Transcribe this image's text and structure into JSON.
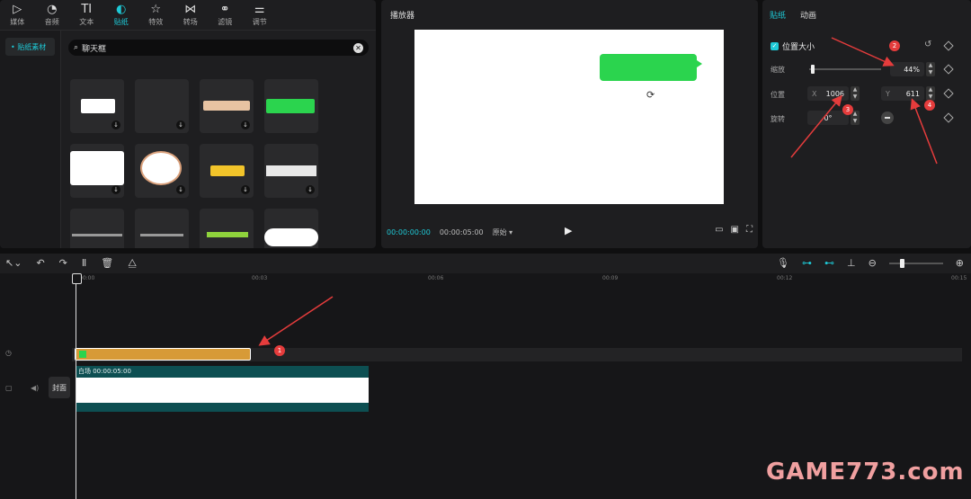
{
  "toolbar": {
    "items": [
      {
        "label": "媒体",
        "icon": "media-icon"
      },
      {
        "label": "音频",
        "icon": "audio-icon"
      },
      {
        "label": "文本",
        "icon": "text-icon"
      },
      {
        "label": "贴纸",
        "icon": "sticker-icon"
      },
      {
        "label": "特效",
        "icon": "effects-icon"
      },
      {
        "label": "转场",
        "icon": "transition-icon"
      },
      {
        "label": "滤镜",
        "icon": "filter-icon"
      },
      {
        "label": "调节",
        "icon": "adjust-icon"
      }
    ],
    "active": "贴纸"
  },
  "library": {
    "side_item": "• 贴纸素材",
    "search_value": "聊天框"
  },
  "player": {
    "title": "播放器",
    "time_current": "00:00:00:00",
    "time_total": "00:00:05:00",
    "ratio_label": "原始 ▾"
  },
  "properties": {
    "tab_active": "贴纸",
    "tab_other": "动画",
    "section_title": "位置大小",
    "scale_label": "缩放",
    "scale_value": "44%",
    "position_label": "位置",
    "x_axis": "X",
    "x_value": "1006",
    "y_axis": "Y",
    "y_value": "611",
    "rotate_label": "旋转",
    "rotate_value": "0°"
  },
  "timeline": {
    "ruler_ticks": [
      "00:00",
      "00:03",
      "00:06",
      "00:09",
      "00:12",
      "00:15"
    ],
    "cover_label": "封面",
    "video_clip_title": "白场   00:00:05:00"
  },
  "annotations": [
    "1",
    "2",
    "3",
    "4"
  ],
  "watermark": "GAME773.com",
  "colors": {
    "accent": "#1ec9d6",
    "sticker_clip": "#d79a37",
    "video_clip": "#0d4f52",
    "chat_bubble": "#2bd44e",
    "annotation": "#e53c3c"
  }
}
